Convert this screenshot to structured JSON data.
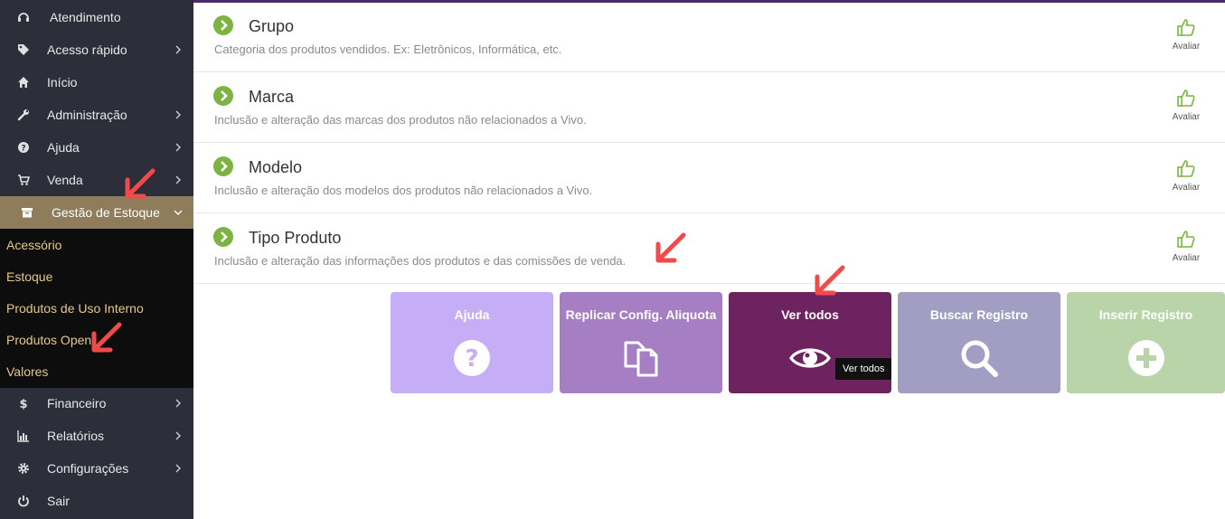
{
  "sidebar": {
    "items": [
      {
        "label": "Atendimento",
        "icon": "headset-icon",
        "chevron": false
      },
      {
        "label": "Acesso rápido",
        "icon": "tag-icon",
        "chevron": true
      },
      {
        "label": "Início",
        "icon": "home-icon",
        "chevron": false
      },
      {
        "label": "Administração",
        "icon": "wrench-icon",
        "chevron": true
      },
      {
        "label": "Ajuda",
        "icon": "question-circle-icon",
        "chevron": true
      },
      {
        "label": "Venda",
        "icon": "cart-icon",
        "chevron": true
      },
      {
        "label": "Gestão de Estoque",
        "icon": "box-icon",
        "chevron": "down"
      },
      {
        "label": "Financeiro",
        "icon": "dollar-icon",
        "chevron": true
      },
      {
        "label": "Relatórios",
        "icon": "bar-chart-icon",
        "chevron": true
      },
      {
        "label": "Configurações",
        "icon": "gear-icon",
        "chevron": true
      },
      {
        "label": "Sair",
        "icon": "power-icon",
        "chevron": false
      }
    ],
    "submenu": [
      "Acessório",
      "Estoque",
      "Produtos de Uso Interno",
      "Produtos Open",
      "Valores"
    ]
  },
  "rows": [
    {
      "title": "Grupo",
      "desc": "Categoria dos produtos vendidos. Ex: Eletrônicos, Informática, etc.",
      "rate_label": "Avaliar"
    },
    {
      "title": "Marca",
      "desc": "Inclusão e alteração das marcas dos produtos não relacionados a Vivo.",
      "rate_label": "Avaliar"
    },
    {
      "title": "Modelo",
      "desc": "Inclusão e alteração dos modelos dos produtos não relacionados a Vivo.",
      "rate_label": "Avaliar"
    },
    {
      "title": "Tipo Produto",
      "desc": "Inclusão e alteração das informações dos produtos e das comissões de venda.",
      "rate_label": "Avaliar"
    }
  ],
  "tiles": [
    {
      "label": "Ajuda",
      "icon": "question-circle-icon",
      "color": "#c5aef5"
    },
    {
      "label": "Replicar Config. Aliquota",
      "icon": "copy-icon",
      "color": "#a67ec4"
    },
    {
      "label": "Ver todos",
      "icon": "eye-icon",
      "color": "#6e2361"
    },
    {
      "label": "Buscar Registro",
      "icon": "search-icon",
      "color": "#a29dc3"
    },
    {
      "label": "Inserir Registro",
      "icon": "plus-circle-icon",
      "color": "#b9d4a9"
    }
  ],
  "tooltip": "Ver todos",
  "colors": {
    "sidebar_bg": "#2c2e3a",
    "submenu_bg": "#0d0d0d",
    "active_bg": "#8f7c5a",
    "submenu_text": "#e6c889",
    "go_icon": "#7cb342",
    "annotation_arrow": "#f04a4a"
  }
}
